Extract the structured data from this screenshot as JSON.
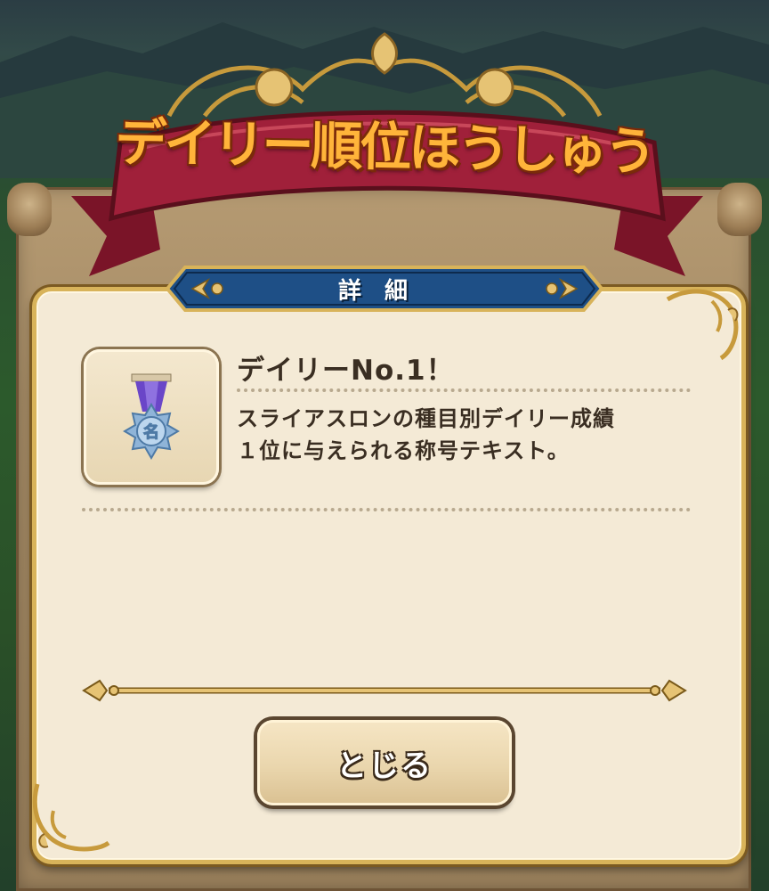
{
  "title": "デイリー順位ほうしゅう",
  "panel": {
    "header_label": "詳細",
    "item": {
      "name": "デイリーNo.1！",
      "icon": "medal-icon",
      "medal_glyph": "名",
      "description_lines": [
        "スライアスロンの種目別デイリー成績",
        "１位に与えられる称号テキスト。"
      ]
    },
    "close_label": "とじる"
  },
  "colors": {
    "title_fill": "#ffb43a",
    "ribbon": "#a0203a",
    "header_bar": "#1e4f86",
    "panel_bg": "#f4ead6",
    "gold_trim": "#d8b35a",
    "text": "#3a2e22"
  }
}
